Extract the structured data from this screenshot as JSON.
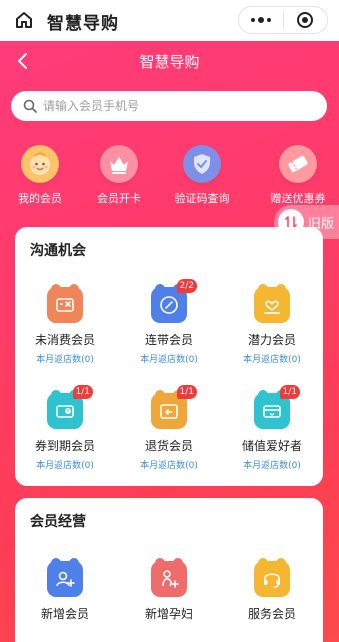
{
  "app_bar": {
    "title": "智慧导购"
  },
  "nav": {
    "title": "智慧导购"
  },
  "search": {
    "placeholder": "请输入会员手机号"
  },
  "quick_actions": [
    {
      "label": "我的会员",
      "icon": "baby-face-icon"
    },
    {
      "label": "会员开卡",
      "icon": "crown-icon"
    },
    {
      "label": "验证码查询",
      "icon": "shield-icon"
    },
    {
      "label": "赠送优惠券",
      "icon": "ticket-icon"
    }
  ],
  "old_version": {
    "label": "旧版"
  },
  "communication": {
    "title": "沟通机会",
    "items": [
      {
        "label": "未消费会员",
        "sub": "本月返店数(0)",
        "badge": "",
        "icon": "no-purchase-icon",
        "color": "#f0855a"
      },
      {
        "label": "连带会员",
        "sub": "本月返店数(0)",
        "badge": "2/2",
        "icon": "link-icon",
        "color": "#4f7fe9"
      },
      {
        "label": "潜力会员",
        "sub": "本月返店数(0)",
        "badge": "",
        "icon": "heart-person-icon",
        "color": "#f5b731"
      },
      {
        "label": "券到期会员",
        "sub": "本月返店数(0)",
        "badge": "1/1",
        "icon": "coupon-expire-icon",
        "color": "#2fc3cf"
      },
      {
        "label": "退货会员",
        "sub": "本月返店数(0)",
        "badge": "1/1",
        "icon": "return-icon",
        "color": "#f0a73a"
      },
      {
        "label": "储值爱好者",
        "sub": "本月返店数(0)",
        "badge": "1/1",
        "icon": "wallet-icon",
        "color": "#2fc3cf"
      }
    ]
  },
  "management": {
    "title": "会员经营",
    "items": [
      {
        "label": "新增会员",
        "icon": "add-member-icon",
        "color": "#4f7fe9"
      },
      {
        "label": "新增孕妇",
        "icon": "add-pregnant-icon",
        "color": "#f06b6b"
      },
      {
        "label": "服务会员",
        "icon": "headset-icon",
        "color": "#f5b731"
      }
    ]
  }
}
